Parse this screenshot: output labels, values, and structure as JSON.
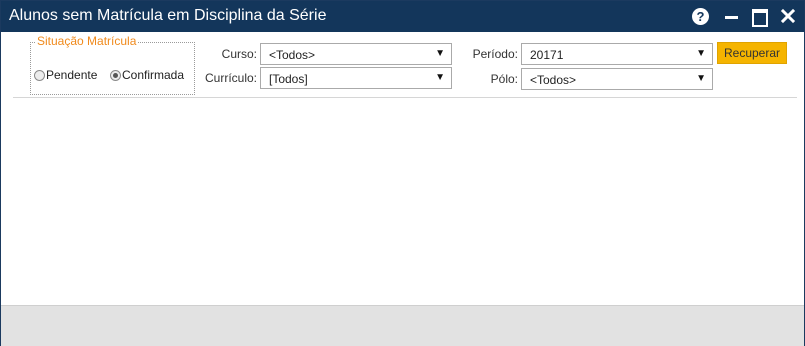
{
  "window": {
    "title": "Alunos sem Matrícula em Disciplina da Série",
    "buttons": {
      "help_icon": "?"
    }
  },
  "filters": {
    "situacao": {
      "legend": "Situação Matrícula",
      "options": [
        {
          "label": "Pendente",
          "checked": false
        },
        {
          "label": "Confirmada",
          "checked": true
        }
      ]
    },
    "curso": {
      "label": "Curso:",
      "value": "<Todos>"
    },
    "curriculo": {
      "label": "Currículo:",
      "value": "[Todos]"
    },
    "periodo": {
      "label": "Período:",
      "value": "20171"
    },
    "polo": {
      "label": "Pólo:",
      "value": "<Todos>"
    },
    "dropdown_arrow": "▼"
  },
  "actions": {
    "recuperar_label": "Recuperar"
  },
  "colors": {
    "titlebar": "#13365b",
    "legend": "#f08a1c",
    "button_accent": "#f5b400",
    "footer": "#e2e2e2"
  }
}
